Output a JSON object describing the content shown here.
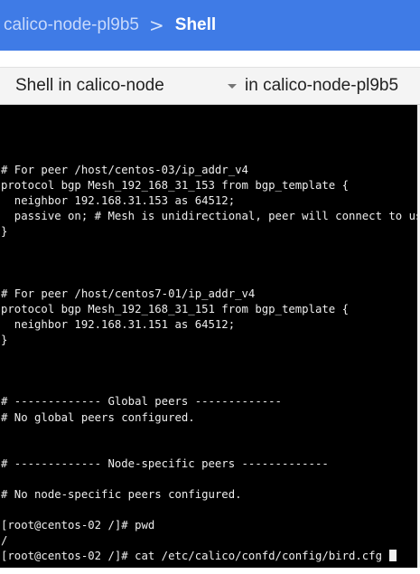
{
  "header": {
    "pod_name": "calico-node-pl9b5",
    "separator": ">",
    "current_page": "Shell"
  },
  "selector": {
    "container_value": "Shell in calico-node",
    "pod_suffix": "in calico-node-pl9b5"
  },
  "terminal": {
    "lines": [
      "# For peer /host/centos-03/ip_addr_v4",
      "protocol bgp Mesh_192_168_31_153 from bgp_template {",
      "  neighbor 192.168.31.153 as 64512;",
      "  passive on; # Mesh is unidirectional, peer will connect to us.",
      "}",
      "",
      "",
      "",
      "# For peer /host/centos7-01/ip_addr_v4",
      "protocol bgp Mesh_192_168_31_151 from bgp_template {",
      "  neighbor 192.168.31.151 as 64512;",
      "}",
      "",
      "",
      "",
      "# ------------- Global peers -------------",
      "# No global peers configured.",
      "",
      "",
      "# ------------- Node-specific peers -------------",
      "",
      "# No node-specific peers configured.",
      "",
      "[root@centos-02 /]# pwd",
      "/",
      "[root@centos-02 /]# cat /etc/calico/confd/config/bird.cfg "
    ],
    "colors": {
      "background": "#000000",
      "text": "#eeeeee"
    }
  },
  "colors": {
    "header_bg": "#3f7be6",
    "header_text": "#ffffff"
  }
}
